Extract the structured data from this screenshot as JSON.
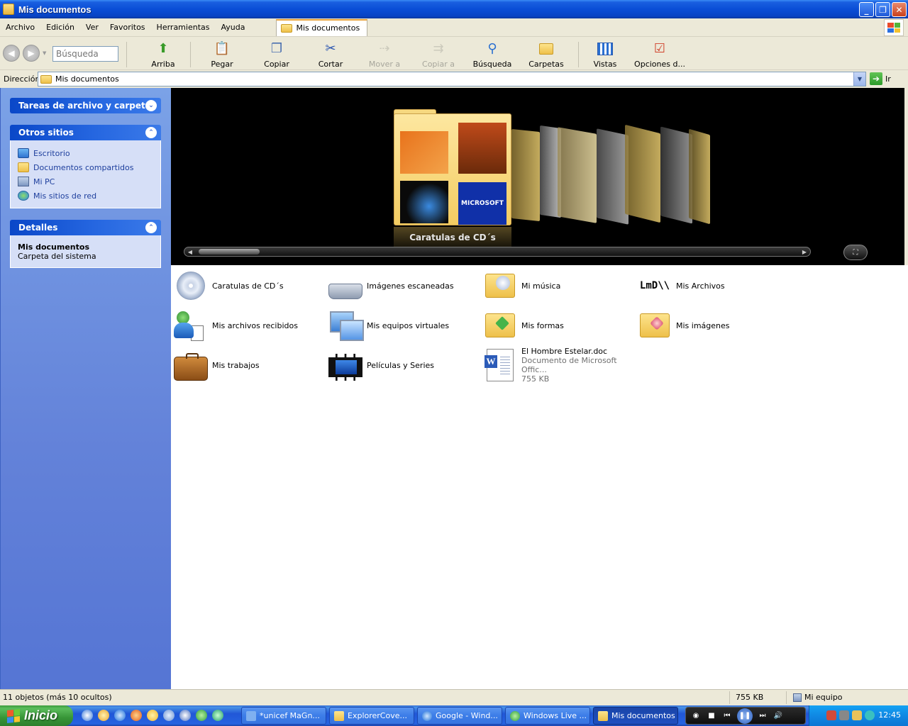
{
  "window": {
    "title": "Mis documentos"
  },
  "menu": {
    "items": [
      "Archivo",
      "Edición",
      "Ver",
      "Favoritos",
      "Herramientas",
      "Ayuda"
    ],
    "tab_label": "Mis documentos"
  },
  "toolbar": {
    "search_placeholder": "Búsqueda",
    "buttons": [
      {
        "label": "Arriba",
        "icon": "up-arrow-icon",
        "enabled": true
      },
      {
        "label": "Pegar",
        "icon": "paste-icon",
        "enabled": true
      },
      {
        "label": "Copiar",
        "icon": "copy-icon",
        "enabled": true
      },
      {
        "label": "Cortar",
        "icon": "scissors-icon",
        "enabled": true
      },
      {
        "label": "Mover a",
        "icon": "move-to-icon",
        "enabled": false
      },
      {
        "label": "Copiar a",
        "icon": "copy-to-icon",
        "enabled": false
      },
      {
        "label": "Búsqueda",
        "icon": "magnifier-icon",
        "enabled": true
      },
      {
        "label": "Carpetas",
        "icon": "folders-icon",
        "enabled": true
      },
      {
        "label": "Vistas",
        "icon": "views-icon",
        "enabled": true
      },
      {
        "label": "Opciones d...",
        "icon": "options-icon",
        "enabled": true
      }
    ]
  },
  "address": {
    "label": "Dirección",
    "value": "Mis documentos",
    "go_label": "Ir"
  },
  "taskpane": {
    "file_tasks_title": "Tareas de archivo y carpeta",
    "other_places_title": "Otros sitios",
    "other_places": [
      "Escritorio",
      "Documentos compartidos",
      "Mi PC",
      "Mis sitios de red"
    ],
    "details_title": "Detalles",
    "details_name": "Mis documentos",
    "details_type": "Carpeta del sistema"
  },
  "coverflow": {
    "caption": "Caratulas de CD´s"
  },
  "files": [
    {
      "name": "Caratulas de CD´s",
      "icon": "cd-folder-icon"
    },
    {
      "name": "Imágenes escaneadas",
      "icon": "scanner-icon"
    },
    {
      "name": "Mi música",
      "icon": "music-folder-icon"
    },
    {
      "name": "Mis Archivos",
      "icon": "lmd-logo-icon"
    },
    {
      "name": "Mis archivos recibidos",
      "icon": "messenger-received-icon"
    },
    {
      "name": "Mis equipos virtuales",
      "icon": "virtual-pc-icon"
    },
    {
      "name": "Mis formas",
      "icon": "forms-folder-icon"
    },
    {
      "name": "Mis imágenes",
      "icon": "pictures-folder-icon"
    },
    {
      "name": "Mis trabajos",
      "icon": "briefcase-icon"
    },
    {
      "name": "Películas y Series",
      "icon": "film-icon"
    },
    {
      "name": "El Hombre Estelar.doc",
      "sub1": "Documento de Microsoft Offic...",
      "sub2": "755 KB",
      "icon": "word-document-icon"
    }
  ],
  "status": {
    "objects": "11 objetos (más 10 ocultos)",
    "size": "755 KB",
    "zone": "Mi equipo"
  },
  "taskbar": {
    "start_label": "Inicio",
    "tasks": [
      {
        "label": "*unicef MaGn...",
        "active": false
      },
      {
        "label": "ExplorerCove...",
        "active": false
      },
      {
        "label": "Google - Wind...",
        "active": false
      },
      {
        "label": "Windows Live ...",
        "active": false
      },
      {
        "label": "Mis documentos",
        "active": true
      }
    ],
    "clock": "12:45"
  }
}
